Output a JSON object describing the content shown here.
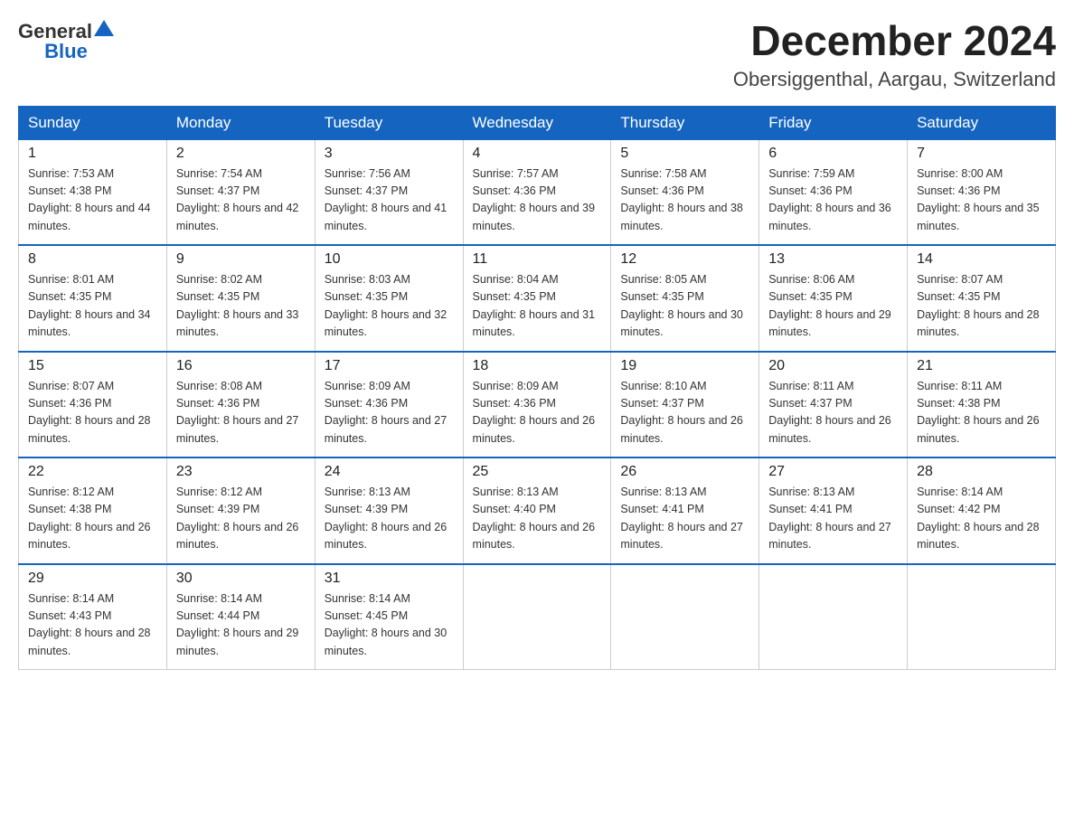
{
  "header": {
    "logo_general": "General",
    "logo_blue": "Blue",
    "month_year": "December 2024",
    "location": "Obersiggenthal, Aargau, Switzerland"
  },
  "calendar": {
    "days_of_week": [
      "Sunday",
      "Monday",
      "Tuesday",
      "Wednesday",
      "Thursday",
      "Friday",
      "Saturday"
    ],
    "weeks": [
      [
        {
          "day": "1",
          "sunrise": "7:53 AM",
          "sunset": "4:38 PM",
          "daylight": "8 hours and 44 minutes."
        },
        {
          "day": "2",
          "sunrise": "7:54 AM",
          "sunset": "4:37 PM",
          "daylight": "8 hours and 42 minutes."
        },
        {
          "day": "3",
          "sunrise": "7:56 AM",
          "sunset": "4:37 PM",
          "daylight": "8 hours and 41 minutes."
        },
        {
          "day": "4",
          "sunrise": "7:57 AM",
          "sunset": "4:36 PM",
          "daylight": "8 hours and 39 minutes."
        },
        {
          "day": "5",
          "sunrise": "7:58 AM",
          "sunset": "4:36 PM",
          "daylight": "8 hours and 38 minutes."
        },
        {
          "day": "6",
          "sunrise": "7:59 AM",
          "sunset": "4:36 PM",
          "daylight": "8 hours and 36 minutes."
        },
        {
          "day": "7",
          "sunrise": "8:00 AM",
          "sunset": "4:36 PM",
          "daylight": "8 hours and 35 minutes."
        }
      ],
      [
        {
          "day": "8",
          "sunrise": "8:01 AM",
          "sunset": "4:35 PM",
          "daylight": "8 hours and 34 minutes."
        },
        {
          "day": "9",
          "sunrise": "8:02 AM",
          "sunset": "4:35 PM",
          "daylight": "8 hours and 33 minutes."
        },
        {
          "day": "10",
          "sunrise": "8:03 AM",
          "sunset": "4:35 PM",
          "daylight": "8 hours and 32 minutes."
        },
        {
          "day": "11",
          "sunrise": "8:04 AM",
          "sunset": "4:35 PM",
          "daylight": "8 hours and 31 minutes."
        },
        {
          "day": "12",
          "sunrise": "8:05 AM",
          "sunset": "4:35 PM",
          "daylight": "8 hours and 30 minutes."
        },
        {
          "day": "13",
          "sunrise": "8:06 AM",
          "sunset": "4:35 PM",
          "daylight": "8 hours and 29 minutes."
        },
        {
          "day": "14",
          "sunrise": "8:07 AM",
          "sunset": "4:35 PM",
          "daylight": "8 hours and 28 minutes."
        }
      ],
      [
        {
          "day": "15",
          "sunrise": "8:07 AM",
          "sunset": "4:36 PM",
          "daylight": "8 hours and 28 minutes."
        },
        {
          "day": "16",
          "sunrise": "8:08 AM",
          "sunset": "4:36 PM",
          "daylight": "8 hours and 27 minutes."
        },
        {
          "day": "17",
          "sunrise": "8:09 AM",
          "sunset": "4:36 PM",
          "daylight": "8 hours and 27 minutes."
        },
        {
          "day": "18",
          "sunrise": "8:09 AM",
          "sunset": "4:36 PM",
          "daylight": "8 hours and 26 minutes."
        },
        {
          "day": "19",
          "sunrise": "8:10 AM",
          "sunset": "4:37 PM",
          "daylight": "8 hours and 26 minutes."
        },
        {
          "day": "20",
          "sunrise": "8:11 AM",
          "sunset": "4:37 PM",
          "daylight": "8 hours and 26 minutes."
        },
        {
          "day": "21",
          "sunrise": "8:11 AM",
          "sunset": "4:38 PM",
          "daylight": "8 hours and 26 minutes."
        }
      ],
      [
        {
          "day": "22",
          "sunrise": "8:12 AM",
          "sunset": "4:38 PM",
          "daylight": "8 hours and 26 minutes."
        },
        {
          "day": "23",
          "sunrise": "8:12 AM",
          "sunset": "4:39 PM",
          "daylight": "8 hours and 26 minutes."
        },
        {
          "day": "24",
          "sunrise": "8:13 AM",
          "sunset": "4:39 PM",
          "daylight": "8 hours and 26 minutes."
        },
        {
          "day": "25",
          "sunrise": "8:13 AM",
          "sunset": "4:40 PM",
          "daylight": "8 hours and 26 minutes."
        },
        {
          "day": "26",
          "sunrise": "8:13 AM",
          "sunset": "4:41 PM",
          "daylight": "8 hours and 27 minutes."
        },
        {
          "day": "27",
          "sunrise": "8:13 AM",
          "sunset": "4:41 PM",
          "daylight": "8 hours and 27 minutes."
        },
        {
          "day": "28",
          "sunrise": "8:14 AM",
          "sunset": "4:42 PM",
          "daylight": "8 hours and 28 minutes."
        }
      ],
      [
        {
          "day": "29",
          "sunrise": "8:14 AM",
          "sunset": "4:43 PM",
          "daylight": "8 hours and 28 minutes."
        },
        {
          "day": "30",
          "sunrise": "8:14 AM",
          "sunset": "4:44 PM",
          "daylight": "8 hours and 29 minutes."
        },
        {
          "day": "31",
          "sunrise": "8:14 AM",
          "sunset": "4:45 PM",
          "daylight": "8 hours and 30 minutes."
        },
        null,
        null,
        null,
        null
      ]
    ]
  }
}
